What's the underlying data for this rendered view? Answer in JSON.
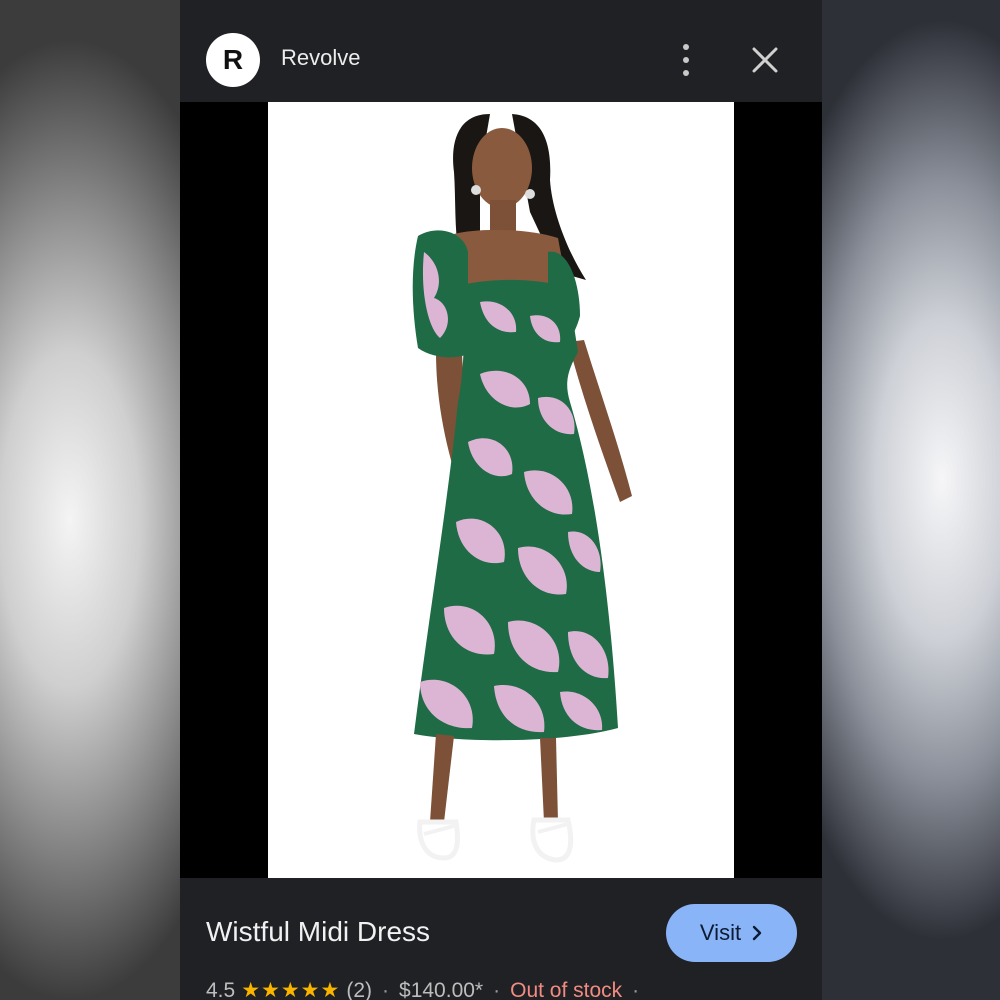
{
  "header": {
    "avatar_letter": "R",
    "site_name": "Revolve"
  },
  "product": {
    "title": "Wistful Midi Dress",
    "visit_label": "Visit",
    "rating": "4.5",
    "stars": "★★★★★",
    "review_count": "(2)",
    "price": "$140.00*",
    "stock_status": "Out of stock"
  },
  "colors": {
    "visit_button": "#8ab4f8",
    "out_of_stock": "#f28b82",
    "star": "#f9b400",
    "panel": "#202124"
  },
  "icons": {
    "more": "more-vert-icon",
    "close": "close-icon",
    "visit_arrow": "chevron-right-icon"
  }
}
